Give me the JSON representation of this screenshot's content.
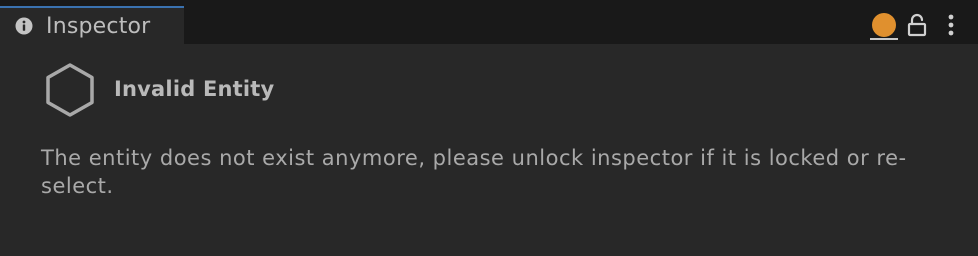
{
  "tab": {
    "title": "Inspector",
    "icon": "info-icon"
  },
  "toolbar": {
    "status_icon": "status-dot-icon",
    "status_color": "#e0902e",
    "lock_icon": "unlocked-padlock-icon",
    "menu_icon": "vertical-ellipsis-icon"
  },
  "entity": {
    "icon": "hexagon-icon",
    "title": "Invalid Entity"
  },
  "message": "The entity does not exist anymore, please unlock inspector if it is locked or re-select."
}
